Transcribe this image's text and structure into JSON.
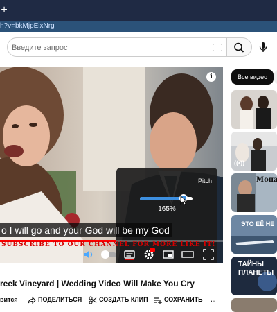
{
  "browser": {
    "new_tab_icon": "plus-icon",
    "url": "h?v=bkMjpEixNrg"
  },
  "header": {
    "search_placeholder": "Введите запрос",
    "keyboard_icon": "keyboard-icon",
    "search_icon": "search-icon",
    "mic_icon": "microphone-icon"
  },
  "player": {
    "subtitle": "o I will go and your God will be my God",
    "banner": "SUBSCRIBE TO OUR CHANNEL FOR MORE LIKE IT!",
    "progress": 0.52,
    "settings_panel": {
      "label": "Pitch",
      "value_text": "165%",
      "slider_level": 0.83
    },
    "controls": [
      "volume-icon",
      "toggle-autoplay",
      "subtitles-icon",
      "settings-icon",
      "miniplayer-icon",
      "theater-icon",
      "fullscreen-icon"
    ]
  },
  "sidebar": {
    "chip_label": "Все видео",
    "thumbnails": [
      {
        "text": ""
      },
      {
        "text": ""
      },
      {
        "text": "Мона"
      },
      {
        "text": "ЭТО ЕЁ НЕ"
      },
      {
        "text": "ТАЙНЫ ПЛАНЕТЫ"
      }
    ]
  },
  "video": {
    "title": "reek Vineyard | Wedding Video Will Make You Cry",
    "actions": {
      "subscribe_tail": "вится",
      "share": "ПОДЕЛИТЬСЯ",
      "clip": "СОЗДАТЬ КЛИП",
      "save": "СОХРАНИТЬ",
      "more": "..."
    }
  },
  "colors": {
    "accent": "#3d8fe0",
    "progress": "#ff0000",
    "banner": "#d60000"
  }
}
